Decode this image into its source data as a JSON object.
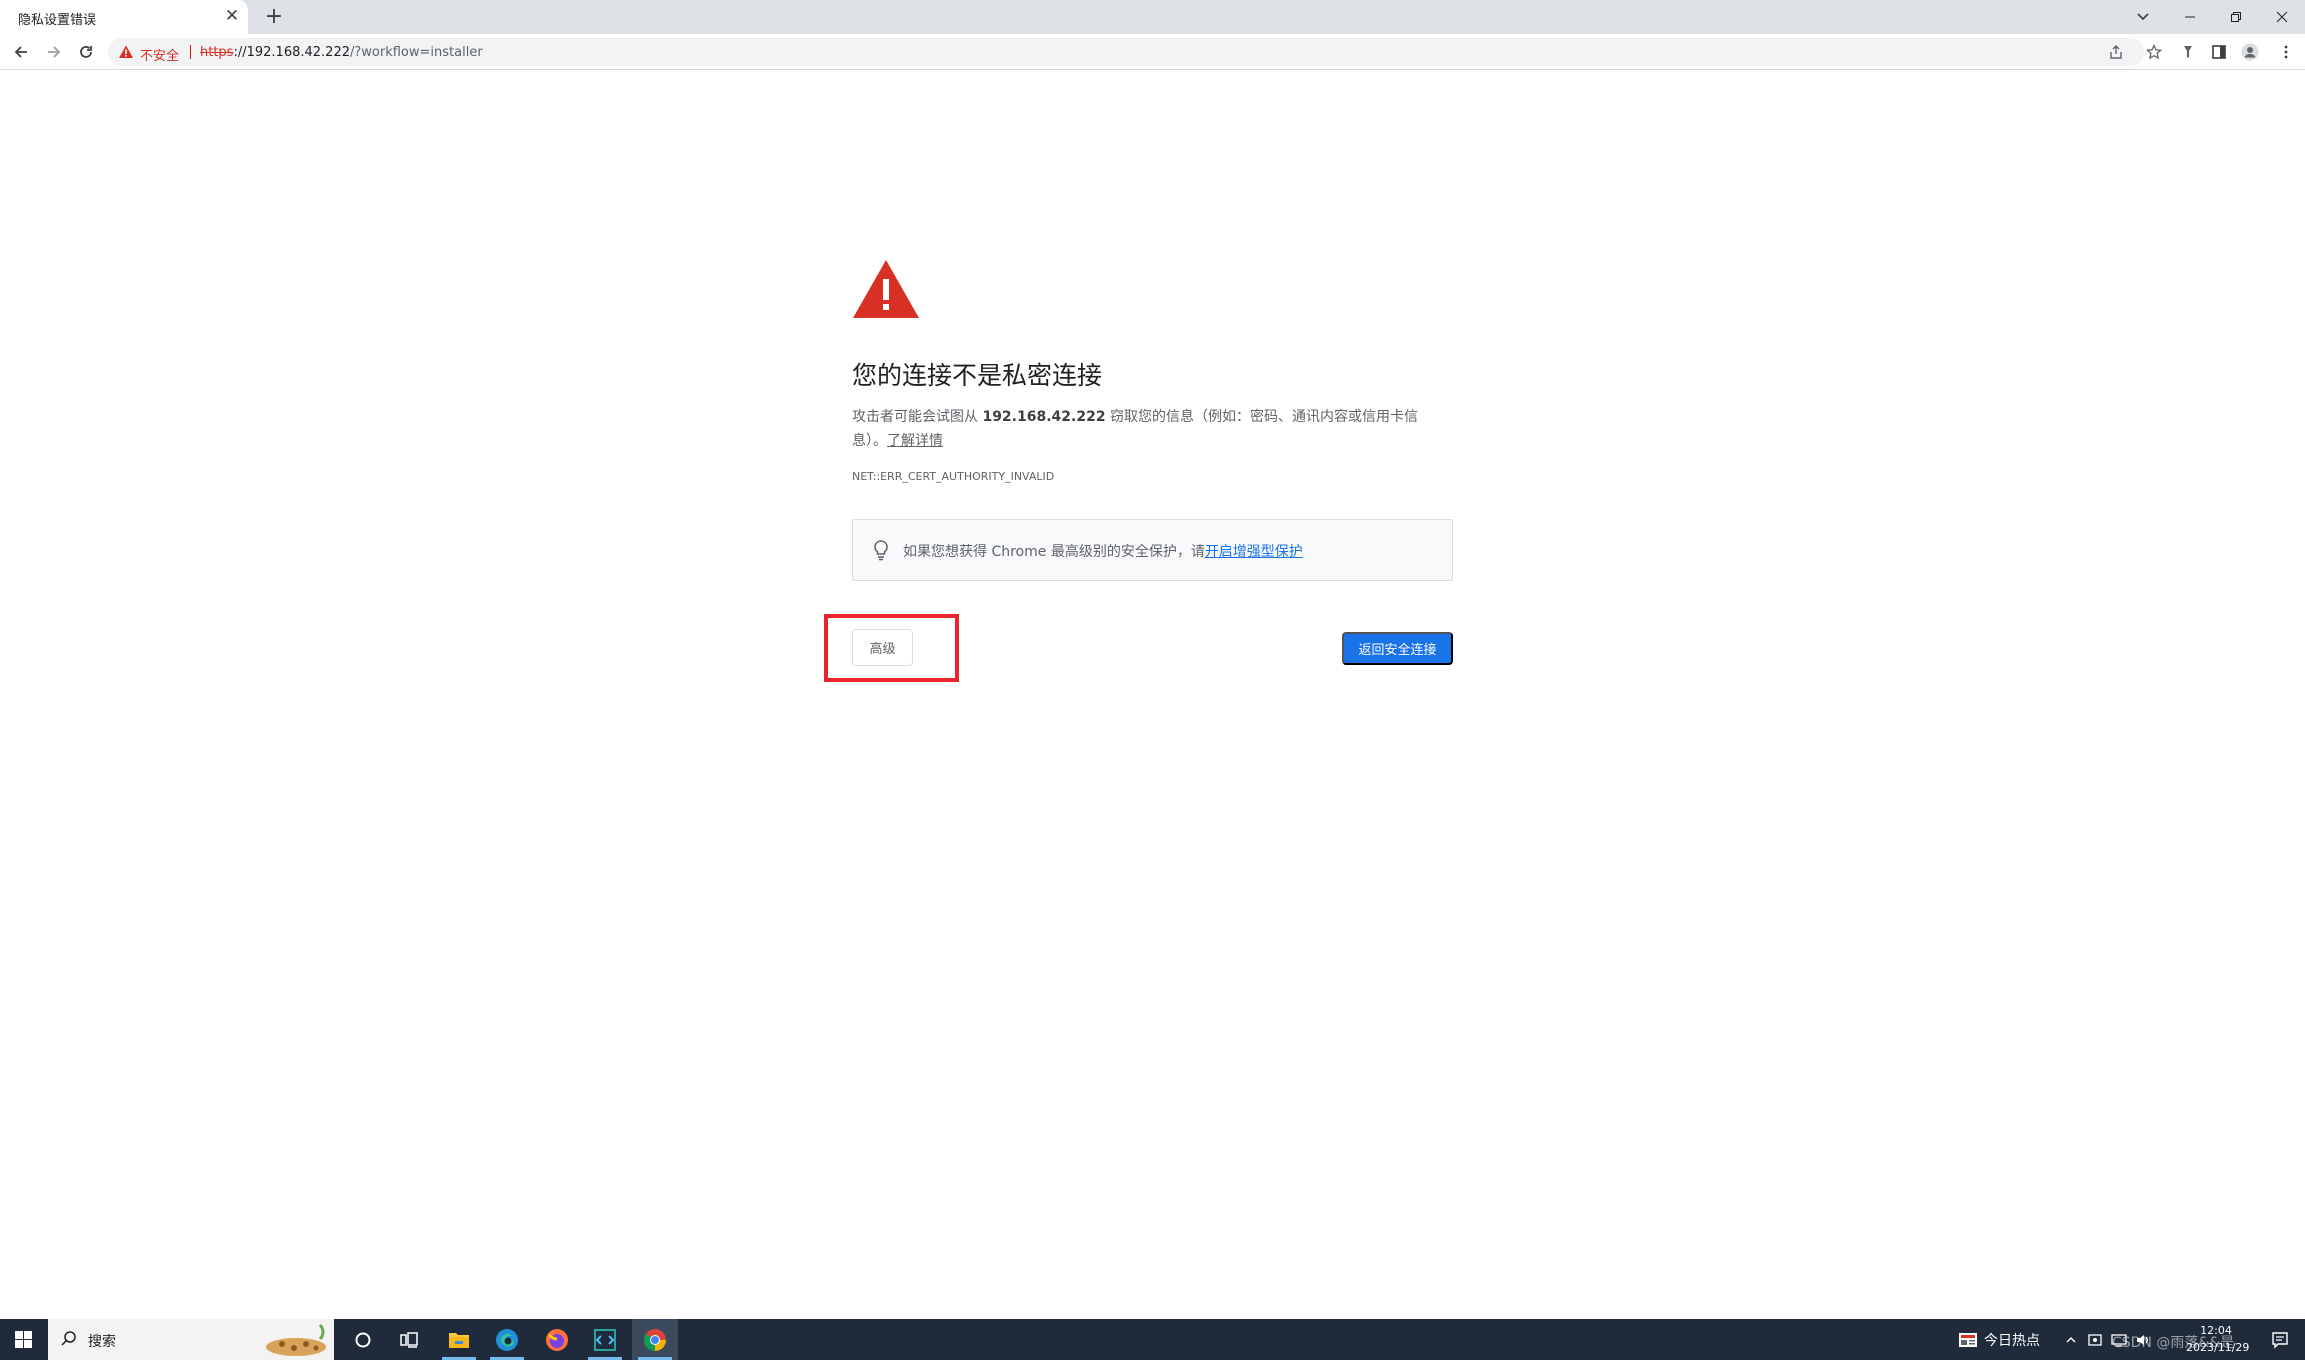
{
  "browser": {
    "tab": {
      "title": "隐私设置错误"
    },
    "address_bar": {
      "security_label": "不安全",
      "url_scheme": "https",
      "url_rest_host": "://192.168.42.222",
      "url_path": "/?workflow=installer"
    }
  },
  "interstitial": {
    "heading": "您的连接不是私密连接",
    "explanation": {
      "before_host": "攻击者可能会试图从 ",
      "host": "192.168.42.222",
      "after_host": " 窃取您的信息（例如：密码、通讯内容或信用卡信息）。",
      "learn_more": "了解详情"
    },
    "error_code": "NET::ERR_CERT_AUTHORITY_INVALID",
    "enhanced_protection": {
      "text": "如果您想获得 Chrome 最高级别的安全保护，请",
      "link": "开启增强型保护"
    },
    "advanced_button": "高级",
    "back_to_safety_button": "返回安全连接"
  },
  "taskbar": {
    "search_label": "搜索",
    "news_label": "今日热点",
    "clock_time": "12:04",
    "clock_date": "2023/11/29",
    "watermark": "CSDN @雨落&&是"
  },
  "colors": {
    "warning_red": "#d93025",
    "link_blue": "#1a73e8",
    "highlight_red": "#e8232a",
    "taskbar_bg": "#1f2b3a"
  },
  "icons": {
    "tabstrip": [
      "close-icon",
      "plus-icon",
      "chevron-down-icon",
      "minimize-icon",
      "restore-icon",
      "close-window-icon"
    ],
    "toolbar": [
      "back-arrow-icon",
      "forward-arrow-icon",
      "reload-icon",
      "warning-icon",
      "share-icon",
      "star-icon",
      "extension-icon",
      "side-panel-icon",
      "profile-icon",
      "more-vert-icon"
    ],
    "page": [
      "warning-triangle-icon",
      "lightbulb-icon"
    ],
    "taskbar": [
      "windows-logo-icon",
      "search-icon",
      "cortana-icon",
      "task-view-icon",
      "file-explorer-icon",
      "edge-icon",
      "firefox-icon",
      "code-icon",
      "chrome-icon",
      "news-icon",
      "chevron-up-icon",
      "network-icon",
      "volume-icon",
      "ime-icon",
      "notification-icon"
    ]
  }
}
